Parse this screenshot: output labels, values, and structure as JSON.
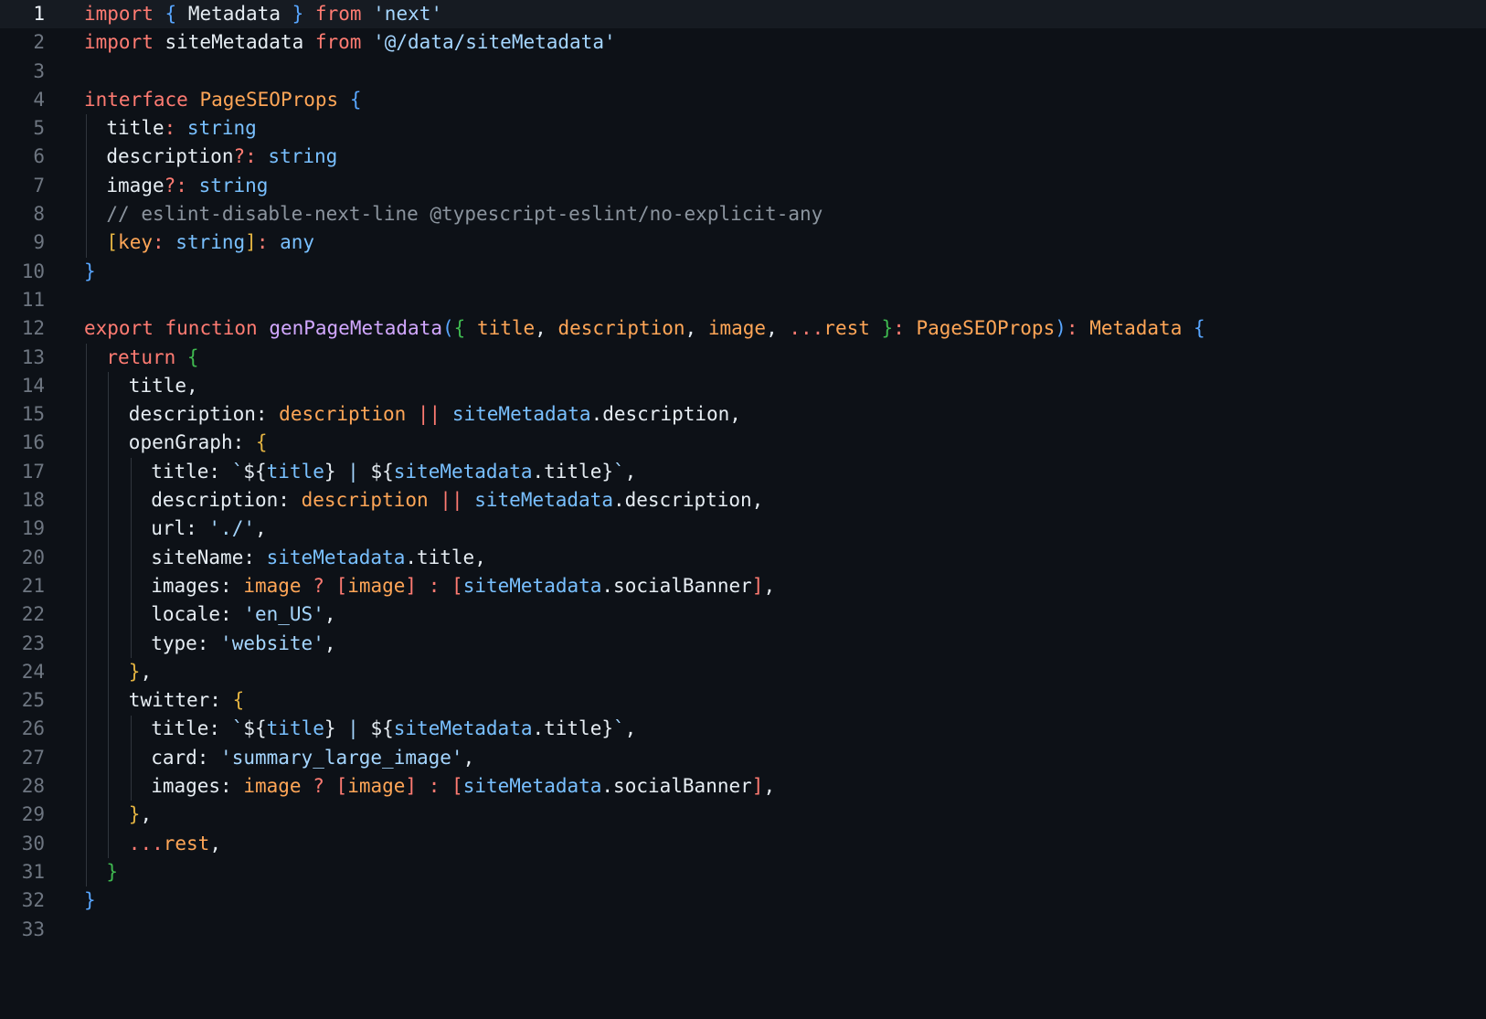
{
  "editor": {
    "active_line": 1,
    "colors": {
      "background": "#0d1117",
      "active_line_background": "#161b22",
      "line_number": "#6e7681",
      "active_line_number": "#f0f6fc",
      "indent_guide": "#30363d",
      "keyword": "#ff7b72",
      "type": "#ffa657",
      "function": "#d2a8ff",
      "string": "#a5d6ff",
      "builtin": "#79c0ff",
      "comment": "#8b949e",
      "plain": "#e6edf3",
      "bracket_blue": "#58a6ff",
      "bracket_green": "#3fb950",
      "bracket_yellow": "#e3b341"
    },
    "lines": [
      {
        "number": "1",
        "indent": 0,
        "tokens": [
          {
            "t": "import",
            "c": "keyword"
          },
          {
            "t": " "
          },
          {
            "t": "{",
            "c": "bracket_blue"
          },
          {
            "t": " Metadata "
          },
          {
            "t": "}",
            "c": "bracket_blue"
          },
          {
            "t": " "
          },
          {
            "t": "from",
            "c": "keyword"
          },
          {
            "t": " "
          },
          {
            "t": "'next'",
            "c": "string"
          }
        ]
      },
      {
        "number": "2",
        "indent": 0,
        "tokens": [
          {
            "t": "import",
            "c": "keyword"
          },
          {
            "t": " siteMetadata "
          },
          {
            "t": "from",
            "c": "keyword"
          },
          {
            "t": " "
          },
          {
            "t": "'@/data/siteMetadata'",
            "c": "string"
          }
        ]
      },
      {
        "number": "3",
        "indent": 0,
        "tokens": []
      },
      {
        "number": "4",
        "indent": 0,
        "tokens": [
          {
            "t": "interface",
            "c": "keyword"
          },
          {
            "t": " "
          },
          {
            "t": "PageSEOProps",
            "c": "type"
          },
          {
            "t": " "
          },
          {
            "t": "{",
            "c": "bracket_blue"
          }
        ]
      },
      {
        "number": "5",
        "indent": 1,
        "tokens": [
          {
            "t": "title"
          },
          {
            "t": ":",
            "c": "keyword"
          },
          {
            "t": " "
          },
          {
            "t": "string",
            "c": "builtin"
          }
        ]
      },
      {
        "number": "6",
        "indent": 1,
        "tokens": [
          {
            "t": "description"
          },
          {
            "t": "?:",
            "c": "keyword"
          },
          {
            "t": " "
          },
          {
            "t": "string",
            "c": "builtin"
          }
        ]
      },
      {
        "number": "7",
        "indent": 1,
        "tokens": [
          {
            "t": "image"
          },
          {
            "t": "?:",
            "c": "keyword"
          },
          {
            "t": " "
          },
          {
            "t": "string",
            "c": "builtin"
          }
        ]
      },
      {
        "number": "8",
        "indent": 1,
        "tokens": [
          {
            "t": "// eslint-disable-next-line @typescript-eslint/no-explicit-any",
            "c": "comment"
          }
        ]
      },
      {
        "number": "9",
        "indent": 1,
        "tokens": [
          {
            "t": "[",
            "c": "bracket_yellow"
          },
          {
            "t": "key",
            "c": "type"
          },
          {
            "t": ":",
            "c": "keyword"
          },
          {
            "t": " "
          },
          {
            "t": "string",
            "c": "builtin"
          },
          {
            "t": "]",
            "c": "bracket_yellow"
          },
          {
            "t": ":",
            "c": "keyword"
          },
          {
            "t": " "
          },
          {
            "t": "any",
            "c": "builtin"
          }
        ]
      },
      {
        "number": "10",
        "indent": 0,
        "tokens": [
          {
            "t": "}",
            "c": "bracket_blue"
          }
        ]
      },
      {
        "number": "11",
        "indent": 0,
        "tokens": []
      },
      {
        "number": "12",
        "indent": 0,
        "tokens": [
          {
            "t": "export",
            "c": "keyword"
          },
          {
            "t": " "
          },
          {
            "t": "function",
            "c": "keyword"
          },
          {
            "t": " "
          },
          {
            "t": "genPageMetadata",
            "c": "function"
          },
          {
            "t": "(",
            "c": "bracket_blue"
          },
          {
            "t": "{",
            "c": "bracket_green"
          },
          {
            "t": " "
          },
          {
            "t": "title",
            "c": "type"
          },
          {
            "t": ", "
          },
          {
            "t": "description",
            "c": "type"
          },
          {
            "t": ", "
          },
          {
            "t": "image",
            "c": "type"
          },
          {
            "t": ", "
          },
          {
            "t": "...",
            "c": "keyword"
          },
          {
            "t": "rest",
            "c": "type"
          },
          {
            "t": " "
          },
          {
            "t": "}",
            "c": "bracket_green"
          },
          {
            "t": ":",
            "c": "keyword"
          },
          {
            "t": " "
          },
          {
            "t": "PageSEOProps",
            "c": "type"
          },
          {
            "t": ")",
            "c": "bracket_blue"
          },
          {
            "t": ":",
            "c": "keyword"
          },
          {
            "t": " "
          },
          {
            "t": "Metadata",
            "c": "type"
          },
          {
            "t": " "
          },
          {
            "t": "{",
            "c": "bracket_blue"
          }
        ]
      },
      {
        "number": "13",
        "indent": 1,
        "tokens": [
          {
            "t": "return",
            "c": "keyword"
          },
          {
            "t": " "
          },
          {
            "t": "{",
            "c": "bracket_green"
          }
        ]
      },
      {
        "number": "14",
        "indent": 2,
        "tokens": [
          {
            "t": "title,"
          }
        ]
      },
      {
        "number": "15",
        "indent": 2,
        "tokens": [
          {
            "t": "description: "
          },
          {
            "t": "description",
            "c": "type"
          },
          {
            "t": " "
          },
          {
            "t": "||",
            "c": "keyword"
          },
          {
            "t": " "
          },
          {
            "t": "siteMetadata",
            "c": "builtin"
          },
          {
            "t": ".description,"
          }
        ]
      },
      {
        "number": "16",
        "indent": 2,
        "tokens": [
          {
            "t": "openGraph: "
          },
          {
            "t": "{",
            "c": "bracket_yellow"
          }
        ]
      },
      {
        "number": "17",
        "indent": 3,
        "tokens": [
          {
            "t": "title: "
          },
          {
            "t": "`",
            "c": "string"
          },
          {
            "t": "${"
          },
          {
            "t": "title",
            "c": "builtin"
          },
          {
            "t": "}"
          },
          {
            "t": " | ",
            "c": "string"
          },
          {
            "t": "${"
          },
          {
            "t": "siteMetadata",
            "c": "builtin"
          },
          {
            "t": ".title}"
          },
          {
            "t": "`",
            "c": "string"
          },
          {
            "t": ","
          }
        ]
      },
      {
        "number": "18",
        "indent": 3,
        "tokens": [
          {
            "t": "description: "
          },
          {
            "t": "description",
            "c": "type"
          },
          {
            "t": " "
          },
          {
            "t": "||",
            "c": "keyword"
          },
          {
            "t": " "
          },
          {
            "t": "siteMetadata",
            "c": "builtin"
          },
          {
            "t": ".description,"
          }
        ]
      },
      {
        "number": "19",
        "indent": 3,
        "tokens": [
          {
            "t": "url: "
          },
          {
            "t": "'./'",
            "c": "string"
          },
          {
            "t": ","
          }
        ]
      },
      {
        "number": "20",
        "indent": 3,
        "tokens": [
          {
            "t": "siteName: "
          },
          {
            "t": "siteMetadata",
            "c": "builtin"
          },
          {
            "t": ".title,"
          }
        ]
      },
      {
        "number": "21",
        "indent": 3,
        "tokens": [
          {
            "t": "images: "
          },
          {
            "t": "image",
            "c": "type"
          },
          {
            "t": " "
          },
          {
            "t": "?",
            "c": "keyword"
          },
          {
            "t": " "
          },
          {
            "t": "[",
            "c": "keyword"
          },
          {
            "t": "image",
            "c": "type"
          },
          {
            "t": "]",
            "c": "keyword"
          },
          {
            "t": " "
          },
          {
            "t": ":",
            "c": "keyword"
          },
          {
            "t": " "
          },
          {
            "t": "[",
            "c": "keyword"
          },
          {
            "t": "siteMetadata",
            "c": "builtin"
          },
          {
            "t": ".socialBanner"
          },
          {
            "t": "]",
            "c": "keyword"
          },
          {
            "t": ","
          }
        ]
      },
      {
        "number": "22",
        "indent": 3,
        "tokens": [
          {
            "t": "locale: "
          },
          {
            "t": "'en_US'",
            "c": "string"
          },
          {
            "t": ","
          }
        ]
      },
      {
        "number": "23",
        "indent": 3,
        "tokens": [
          {
            "t": "type: "
          },
          {
            "t": "'website'",
            "c": "string"
          },
          {
            "t": ","
          }
        ]
      },
      {
        "number": "24",
        "indent": 2,
        "tokens": [
          {
            "t": "}",
            "c": "bracket_yellow"
          },
          {
            "t": ","
          }
        ]
      },
      {
        "number": "25",
        "indent": 2,
        "tokens": [
          {
            "t": "twitter: "
          },
          {
            "t": "{",
            "c": "bracket_yellow"
          }
        ]
      },
      {
        "number": "26",
        "indent": 3,
        "tokens": [
          {
            "t": "title: "
          },
          {
            "t": "`",
            "c": "string"
          },
          {
            "t": "${"
          },
          {
            "t": "title",
            "c": "builtin"
          },
          {
            "t": "}"
          },
          {
            "t": " | ",
            "c": "string"
          },
          {
            "t": "${"
          },
          {
            "t": "siteMetadata",
            "c": "builtin"
          },
          {
            "t": ".title}"
          },
          {
            "t": "`",
            "c": "string"
          },
          {
            "t": ","
          }
        ]
      },
      {
        "number": "27",
        "indent": 3,
        "tokens": [
          {
            "t": "card: "
          },
          {
            "t": "'summary_large_image'",
            "c": "string"
          },
          {
            "t": ","
          }
        ]
      },
      {
        "number": "28",
        "indent": 3,
        "tokens": [
          {
            "t": "images: "
          },
          {
            "t": "image",
            "c": "type"
          },
          {
            "t": " "
          },
          {
            "t": "?",
            "c": "keyword"
          },
          {
            "t": " "
          },
          {
            "t": "[",
            "c": "keyword"
          },
          {
            "t": "image",
            "c": "type"
          },
          {
            "t": "]",
            "c": "keyword"
          },
          {
            "t": " "
          },
          {
            "t": ":",
            "c": "keyword"
          },
          {
            "t": " "
          },
          {
            "t": "[",
            "c": "keyword"
          },
          {
            "t": "siteMetadata",
            "c": "builtin"
          },
          {
            "t": ".socialBanner"
          },
          {
            "t": "]",
            "c": "keyword"
          },
          {
            "t": ","
          }
        ]
      },
      {
        "number": "29",
        "indent": 2,
        "tokens": [
          {
            "t": "}",
            "c": "bracket_yellow"
          },
          {
            "t": ","
          }
        ]
      },
      {
        "number": "30",
        "indent": 2,
        "tokens": [
          {
            "t": "...",
            "c": "keyword"
          },
          {
            "t": "rest",
            "c": "type"
          },
          {
            "t": ","
          }
        ]
      },
      {
        "number": "31",
        "indent": 1,
        "tokens": [
          {
            "t": "}",
            "c": "bracket_green"
          }
        ]
      },
      {
        "number": "32",
        "indent": 0,
        "tokens": [
          {
            "t": "}",
            "c": "bracket_blue"
          }
        ]
      },
      {
        "number": "33",
        "indent": 0,
        "tokens": []
      }
    ]
  }
}
